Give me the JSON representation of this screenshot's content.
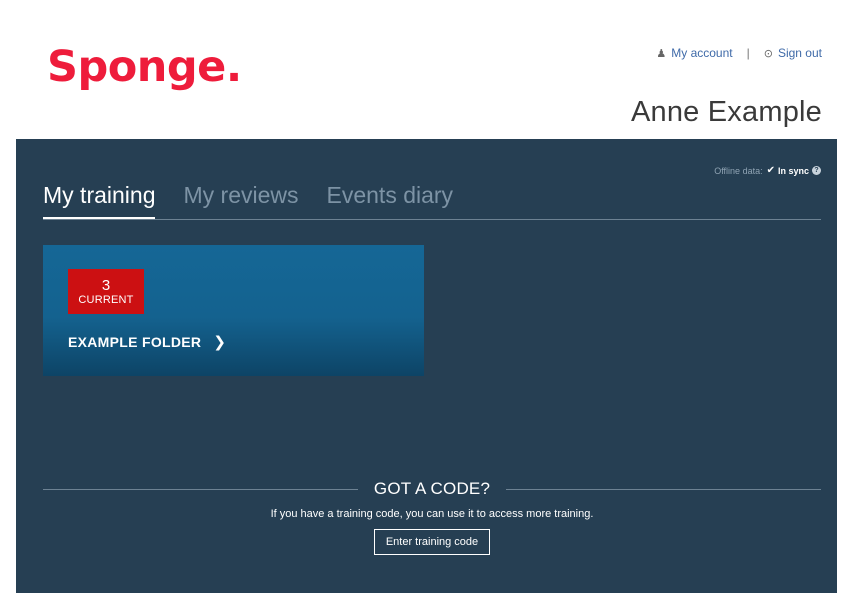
{
  "brand": {
    "logo_text": "Sponge.",
    "color": "#ee1c3b"
  },
  "header": {
    "my_account_label": "My account",
    "my_account_icon": "user-icon",
    "separator": "|",
    "sign_out_label": "Sign out",
    "sign_out_icon": "sign-out-icon",
    "user_name": "Anne Example"
  },
  "panel": {
    "background": "#263f53",
    "offline": {
      "label": "Offline data:",
      "status_icon": "check-icon",
      "status": "In sync",
      "help_icon": "question-circle-icon",
      "help_glyph": "?"
    },
    "tabs": [
      {
        "label": "My training",
        "active": true
      },
      {
        "label": "My reviews",
        "active": false
      },
      {
        "label": "Events diary",
        "active": false
      }
    ],
    "folders": [
      {
        "count": "3",
        "count_label": "CURRENT",
        "title": "EXAMPLE FOLDER",
        "chevron_icon": "chevron-right-icon",
        "badge_color": "#cc1012"
      }
    ],
    "code": {
      "heading": "GOT A CODE?",
      "description": "If you have a training code, you can use it to access more training.",
      "button_label": "Enter training code"
    }
  }
}
